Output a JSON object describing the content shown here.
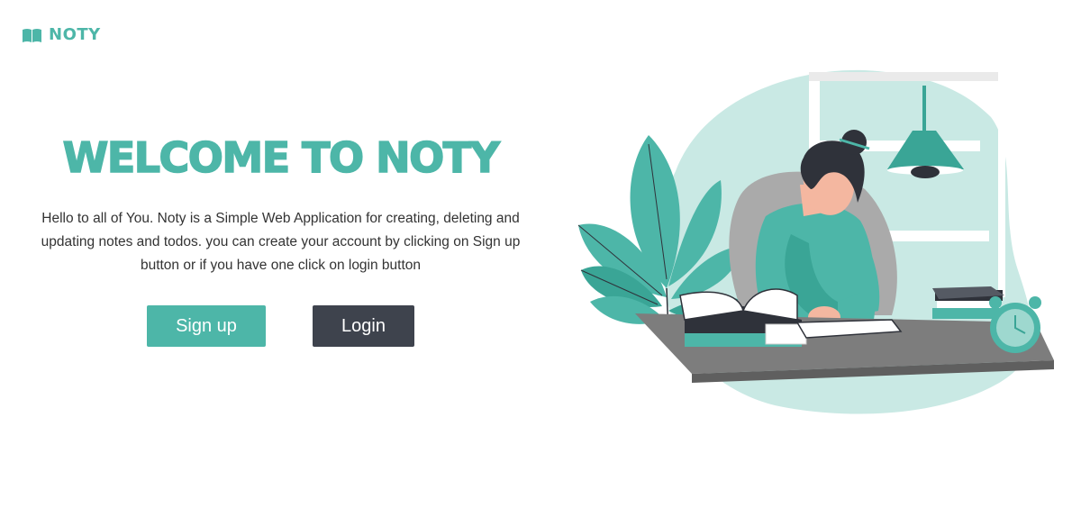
{
  "brand": {
    "name": "NOTY",
    "icon": "book-icon",
    "color": "#4db6a8"
  },
  "hero": {
    "title": "WELCOME TO NOTY",
    "description": "Hello to all of You. Noty is a Simple Web Application for creating, deleting and updating notes and todos. you can create your account by clicking on Sign up button or if you have one click on login button"
  },
  "actions": {
    "signup_label": "Sign up",
    "login_label": "Login"
  },
  "colors": {
    "accent": "#4db6a8",
    "dark": "#3e434d",
    "text": "#333333"
  }
}
